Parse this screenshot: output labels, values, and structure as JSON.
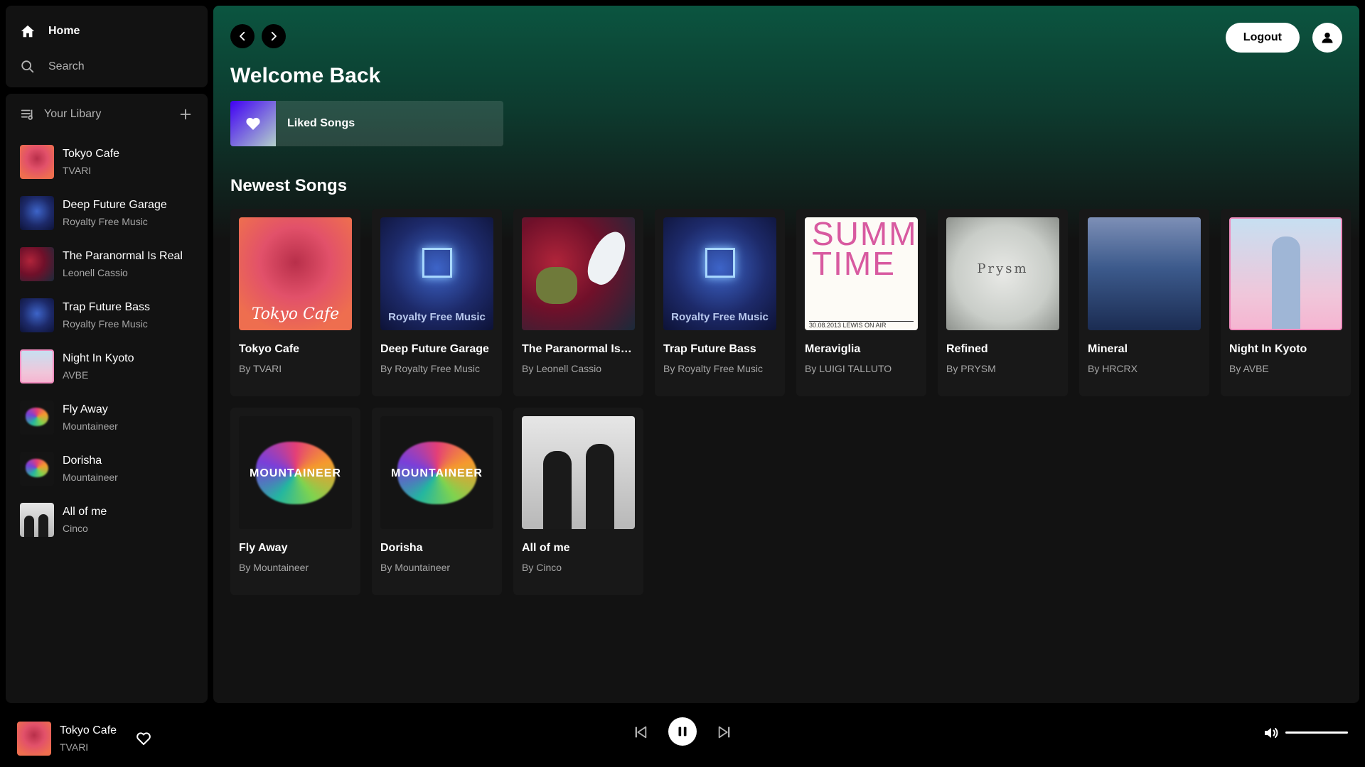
{
  "nav": {
    "home": "Home",
    "search": "Search"
  },
  "library": {
    "title": "Your Libary",
    "items": [
      {
        "title": "Tokyo Cafe",
        "artist": "TVARI"
      },
      {
        "title": "Deep Future Garage",
        "artist": "Royalty Free Music"
      },
      {
        "title": "The Paranormal Is Real",
        "artist": "Leonell Cassio"
      },
      {
        "title": "Trap Future Bass",
        "artist": "Royalty Free Music"
      },
      {
        "title": "Night In Kyoto",
        "artist": "AVBE"
      },
      {
        "title": "Fly Away",
        "artist": "Mountaineer"
      },
      {
        "title": "Dorisha",
        "artist": "Mountaineer"
      },
      {
        "title": "All of me",
        "artist": "Cinco"
      }
    ]
  },
  "header": {
    "logout": "Logout",
    "welcome": "Welcome Back",
    "liked": "Liked Songs"
  },
  "newest": {
    "title": "Newest Songs",
    "cards": [
      {
        "title": "Tokyo Cafe",
        "by": "By TVARI"
      },
      {
        "title": "Deep Future Garage",
        "by": "By Royalty Free Music"
      },
      {
        "title": "The Paranormal Is R...",
        "by": "By Leonell Cassio"
      },
      {
        "title": "Trap Future Bass",
        "by": "By Royalty Free Music"
      },
      {
        "title": "Meraviglia",
        "by": "By LUIGI TALLUTO"
      },
      {
        "title": "Refined",
        "by": "By PRYSM"
      },
      {
        "title": "Mineral",
        "by": "By HRCRX"
      },
      {
        "title": "Night In Kyoto",
        "by": "By AVBE"
      },
      {
        "title": "Fly Away",
        "by": "By Mountaineer"
      },
      {
        "title": "Dorisha",
        "by": "By Mountaineer"
      },
      {
        "title": "All of me",
        "by": "By Cinco"
      }
    ]
  },
  "cover_text": {
    "royalty": "Royalty Free Music",
    "tokyo": "Tokyo Cafe",
    "summer": "SUMMER TIME",
    "summer_foot": "30.08.2013   LEWIS ON AIR",
    "prysm": "Prysm",
    "mountaineer": "MOUNTAINEER"
  },
  "player": {
    "title": "Tokyo Cafe",
    "artist": "TVARI",
    "volume": 1.0
  },
  "colors": {
    "accent": "#0b5540",
    "background": "#121212",
    "text_muted": "#a7a7a7"
  }
}
